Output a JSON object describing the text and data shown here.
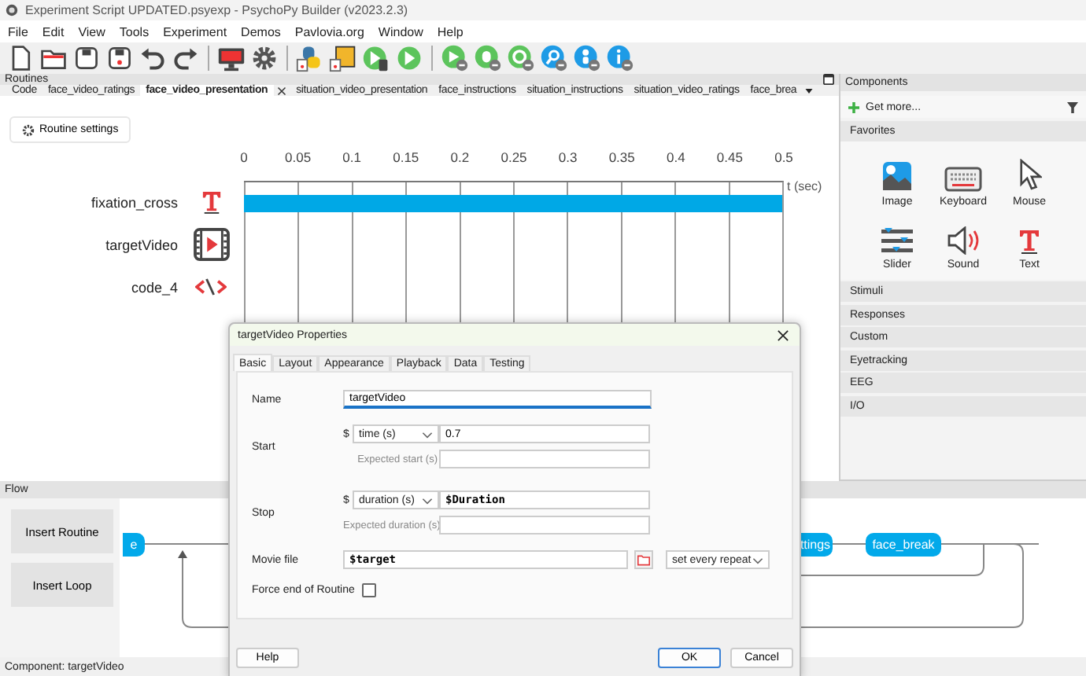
{
  "window": {
    "title": "Experiment Script UPDATED.psyexp - PsychoPy Builder (v2023.2.3)"
  },
  "menu": [
    "File",
    "Edit",
    "View",
    "Tools",
    "Experiment",
    "Demos",
    "Pavlovia.org",
    "Window",
    "Help"
  ],
  "routines": {
    "title": "Routines",
    "tabs": [
      {
        "label": "Code",
        "selected": false
      },
      {
        "label": "face_video_ratings",
        "selected": false
      },
      {
        "label": "face_video_presentation",
        "selected": true
      },
      {
        "label": "situation_video_presentation",
        "selected": false
      },
      {
        "label": "face_instructions",
        "selected": false
      },
      {
        "label": "situation_instructions",
        "selected": false
      },
      {
        "label": "situation_video_ratings",
        "selected": false
      },
      {
        "label": "face_brea",
        "selected": false
      }
    ],
    "settings_button": "Routine settings",
    "ticks": [
      "0",
      "0.05",
      "0.1",
      "0.15",
      "0.2",
      "0.25",
      "0.3",
      "0.35",
      "0.4",
      "0.45",
      "0.5"
    ],
    "axis_label": "t (sec)",
    "components": [
      {
        "name": "fixation_cross",
        "kind": "text",
        "level": 1
      },
      {
        "name": "targetVideo",
        "kind": "movie"
      },
      {
        "name": "code_4",
        "kind": "code"
      }
    ]
  },
  "components_panel": {
    "title": "Components",
    "get_more": "Get more...",
    "favorites_title": "Favorites",
    "favorites": [
      {
        "label": "Image",
        "kind": "image"
      },
      {
        "label": "Keyboard",
        "kind": "keyboard"
      },
      {
        "label": "Mouse",
        "kind": "mouse"
      },
      {
        "label": "Slider",
        "kind": "slider"
      },
      {
        "label": "Sound",
        "kind": "sound"
      },
      {
        "label": "Text",
        "kind": "text"
      }
    ],
    "categories": [
      "Stimuli",
      "Responses",
      "Custom",
      "Eyetracking",
      "EEG",
      "I/O"
    ]
  },
  "flow": {
    "title": "Flow",
    "buttons": [
      "Insert Routine",
      "Insert Loop"
    ],
    "routines": [
      "e",
      "ttings",
      "face_break"
    ]
  },
  "status_bar": "Component: targetVideo",
  "dialog": {
    "title": "targetVideo Properties",
    "tabs": [
      {
        "label": "Basic",
        "selected": true
      },
      {
        "label": "Layout",
        "selected": false
      },
      {
        "label": "Appearance",
        "selected": false
      },
      {
        "label": "Playback",
        "selected": false
      },
      {
        "label": "Data",
        "selected": false
      },
      {
        "label": "Testing",
        "selected": false
      }
    ],
    "name": {
      "label": "Name",
      "value": "targetVideo"
    },
    "start": {
      "label": "Start",
      "prefix": "$",
      "type": "time (s)",
      "value": "0.7",
      "expected_label": "Expected start (s)"
    },
    "stop": {
      "label": "Stop",
      "prefix": "$",
      "type": "duration (s)",
      "value": "$Duration",
      "expected_label": "Expected duration (s)"
    },
    "movie_file": {
      "label": "Movie file",
      "value": "$target",
      "update": "set every repeat"
    },
    "force_end": {
      "label": "Force end of Routine",
      "checked": false
    },
    "buttons": [
      {
        "label": "Help",
        "default": false
      },
      {
        "label": "OK",
        "default": true
      },
      {
        "label": "Cancel",
        "default": false
      }
    ]
  }
}
